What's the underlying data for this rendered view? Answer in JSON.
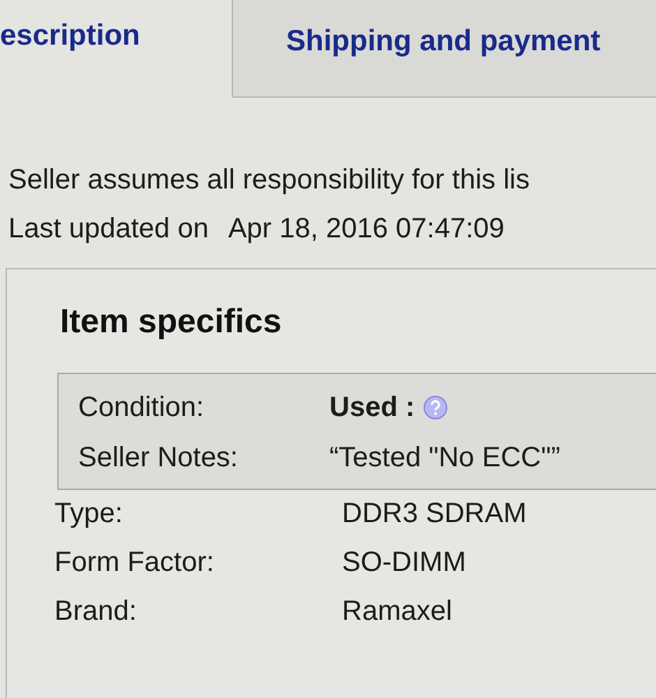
{
  "tabs": [
    {
      "label": "escription",
      "selected": true
    },
    {
      "label": "Shipping and payment",
      "selected": false
    }
  ],
  "notice": "Seller assumes all responsibility for this lis",
  "last_updated": {
    "label": "Last updated on",
    "value": "Apr 18, 2016 07:47:09"
  },
  "item_specifics": {
    "title": "Item specifics",
    "rows": [
      {
        "kind": "highlighted",
        "label": "Condition:",
        "value": "Used :",
        "help": true
      },
      {
        "kind": "highlighted",
        "label": "Seller Notes:",
        "value": "“Tested \"No ECC\"”",
        "help": false
      },
      {
        "kind": "plain",
        "label": "Type:",
        "value": "DDR3 SDRAM",
        "help": false
      },
      {
        "kind": "plain",
        "label": "Form Factor:",
        "value": "SO-DIMM",
        "help": false
      },
      {
        "kind": "plain",
        "label": "Brand:",
        "value": "Ramaxel",
        "help": false
      }
    ]
  }
}
